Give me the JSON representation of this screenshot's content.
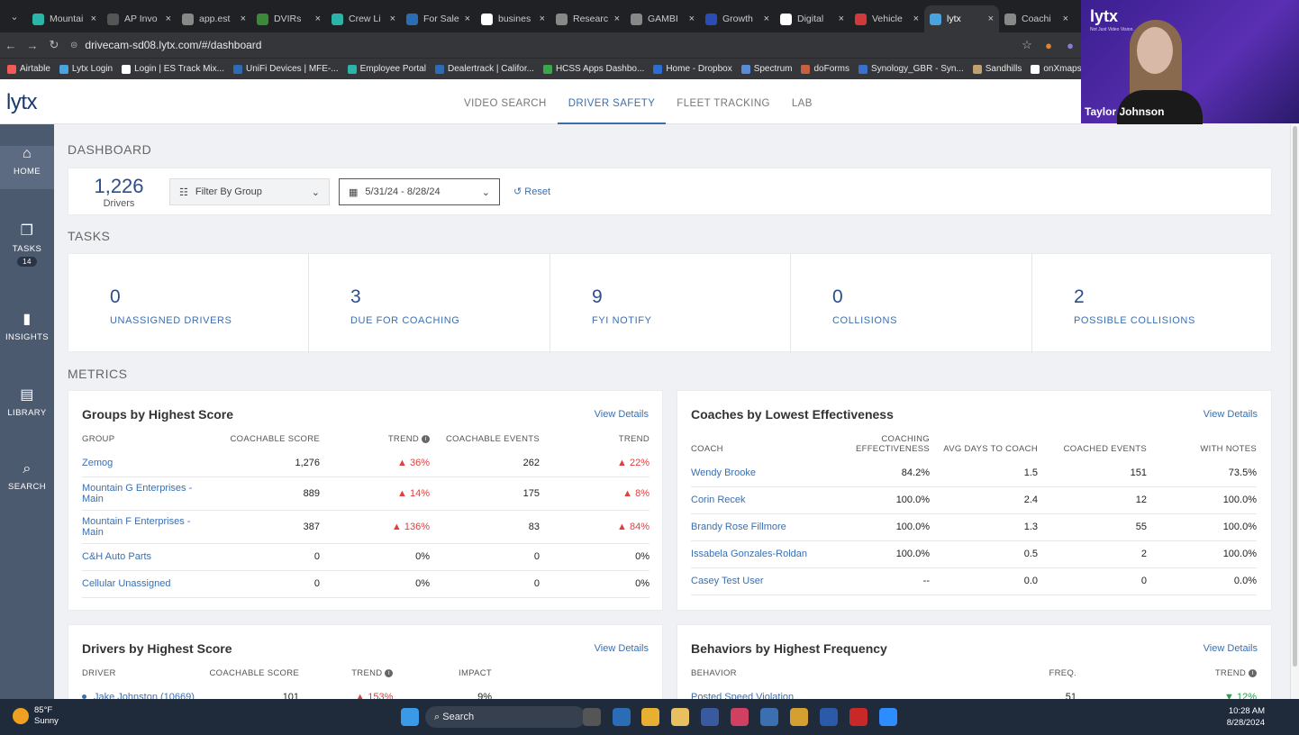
{
  "browser": {
    "tabs": [
      {
        "title": "Mountai",
        "color": "#2bb5a8"
      },
      {
        "title": "AP Invo",
        "color": "#555555"
      },
      {
        "title": "app.est",
        "color": "#888888"
      },
      {
        "title": "DVIRs",
        "color": "#3a8a3a"
      },
      {
        "title": "Crew Li",
        "color": "#2bb5a8"
      },
      {
        "title": "For Sale",
        "color": "#2b6cb5"
      },
      {
        "title": "busines",
        "color": "#ffffff"
      },
      {
        "title": "Researc",
        "color": "#888888"
      },
      {
        "title": "GAMBI",
        "color": "#888888"
      },
      {
        "title": "Growth",
        "color": "#2b4cb5"
      },
      {
        "title": "Digital",
        "color": "#ffffff"
      },
      {
        "title": "Vehicle",
        "color": "#d03a3a"
      },
      {
        "title": "lytx",
        "color": "#4aa3df"
      },
      {
        "title": "Coachi",
        "color": "#888888"
      }
    ],
    "url": "drivecam-sd08.lytx.com/#/dashboard",
    "bookmarks": [
      "Airtable",
      "Lytx Login",
      "Login | ES Track Mix...",
      "UniFi Devices | MFE-...",
      "Employee Portal",
      "Dealertrack | Califor...",
      "HCSS Apps Dashbo...",
      "Home - Dropbox",
      "Spectrum",
      "doForms",
      "Synology_GBR - Syn...",
      "Sandhills",
      "onXmaps Web App"
    ]
  },
  "video": {
    "logo": "lytx",
    "tagline": "Not Just Video Vision.",
    "name": "Taylor Johnson"
  },
  "app": {
    "brand": "lytx",
    "nav": [
      "VIDEO SEARCH",
      "DRIVER SAFETY",
      "FLEET TRACKING",
      "LAB"
    ],
    "sidebar": [
      {
        "label": "HOME",
        "icon": "home-icon"
      },
      {
        "label": "TASKS",
        "icon": "tasks-icon",
        "badge": "14"
      },
      {
        "label": "INSIGHTS",
        "icon": "insights-icon"
      },
      {
        "label": "LIBRARY",
        "icon": "library-icon"
      },
      {
        "label": "SEARCH",
        "icon": "search-icon"
      }
    ],
    "dashboard_title": "DASHBOARD",
    "drivers_count": "1,226",
    "drivers_label": "Drivers",
    "filter_group": "Filter By Group",
    "date_range": "5/31/24 - 8/28/24",
    "reset": "Reset",
    "tasks_title": "TASKS",
    "tasks": [
      {
        "n": "0",
        "label": "UNASSIGNED DRIVERS"
      },
      {
        "n": "3",
        "label": "DUE FOR COACHING"
      },
      {
        "n": "9",
        "label": "FYI NOTIFY"
      },
      {
        "n": "0",
        "label": "COLLISIONS"
      },
      {
        "n": "2",
        "label": "POSSIBLE COLLISIONS"
      }
    ],
    "metrics_title": "METRICS",
    "view_details": "View Details",
    "groups": {
      "title": "Groups by Highest Score",
      "headers": [
        "GROUP",
        "COACHABLE SCORE",
        "TREND",
        "COACHABLE EVENTS",
        "TREND"
      ],
      "rows": [
        [
          "Zemog",
          "1,276",
          "36%",
          "262",
          "22%"
        ],
        [
          "Mountain G Enterprises - Main",
          "889",
          "14%",
          "175",
          "8%"
        ],
        [
          "Mountain F Enterprises - Main",
          "387",
          "136%",
          "83",
          "84%"
        ],
        [
          "C&H Auto Parts",
          "0",
          "0%",
          "0",
          "0%"
        ],
        [
          "Cellular Unassigned",
          "0",
          "0%",
          "0",
          "0%"
        ]
      ]
    },
    "coaches": {
      "title": "Coaches by Lowest Effectiveness",
      "headers": [
        "COACH",
        "COACHING EFFECTIVENESS",
        "AVG DAYS TO COACH",
        "COACHED EVENTS",
        "WITH NOTES"
      ],
      "rows": [
        [
          "Wendy Brooke",
          "84.2%",
          "1.5",
          "151",
          "73.5%"
        ],
        [
          "Corin Recek",
          "100.0%",
          "2.4",
          "12",
          "100.0%"
        ],
        [
          "Brandy Rose Fillmore",
          "100.0%",
          "1.3",
          "55",
          "100.0%"
        ],
        [
          "Issabela Gonzales-Roldan",
          "100.0%",
          "0.5",
          "2",
          "100.0%"
        ],
        [
          "Casey Test User",
          "--",
          "0.0",
          "0",
          "0.0%"
        ]
      ]
    },
    "drivers": {
      "title": "Drivers by Highest Score",
      "headers": [
        "DRIVER",
        "COACHABLE SCORE",
        "TREND",
        "IMPACT"
      ],
      "rows": [
        [
          "Jake Johnston (10669)",
          "101",
          "153%",
          "9%"
        ]
      ]
    },
    "behaviors": {
      "title": "Behaviors by Highest Frequency",
      "headers": [
        "BEHAVIOR",
        "FREQ.",
        "TREND"
      ],
      "rows": [
        [
          "Posted Speed Violation",
          "51",
          "12%"
        ]
      ]
    }
  },
  "taskbar": {
    "temp": "85°F",
    "weather": "Sunny",
    "search": "Search",
    "time": "10:28 AM",
    "date": "8/28/2024"
  }
}
